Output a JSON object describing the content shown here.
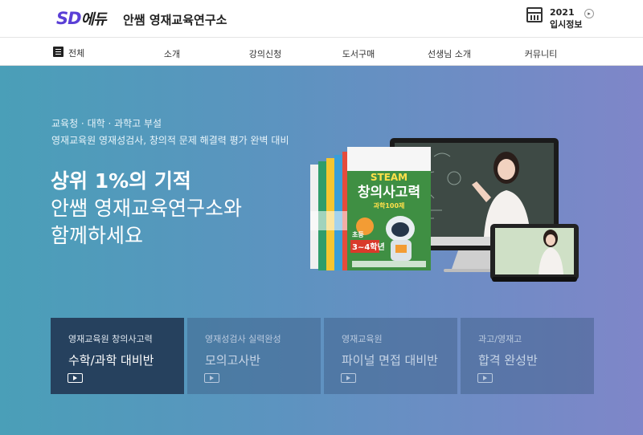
{
  "brand": {
    "logo_sd": "SD",
    "logo_edu": "에듀",
    "org_name": "안쌤 영재교육연구소"
  },
  "header_info": {
    "year": "2021",
    "label": "입시정보",
    "icon": "calendar-icon",
    "arrow_icon": "chevron-right-icon"
  },
  "nav": {
    "all_label": "전체",
    "items": [
      "소개",
      "강의신청",
      "도서구매",
      "선생님 소개",
      "커뮤니티"
    ]
  },
  "hero": {
    "sub1": "교육청 · 대학 · 과학고 부설",
    "sub2": "영재교육원 영재성검사, 창의적 문제 해결력 평가 완벽 대비",
    "title1": "상위 1%의 기적",
    "title2": "안쌤 영재교육연구소와",
    "title3": "함께하세요",
    "book": {
      "badge": "STEAM",
      "title": "창의사고력",
      "subtitle": "과학100제",
      "grade_prefix": "초등",
      "grade": "3~4학년"
    }
  },
  "courses": [
    {
      "category": "영재교육원 창의사고력",
      "name": "수학/과학 대비반",
      "active": true
    },
    {
      "category": "영재성검사 실력완성",
      "name": "모의고사반",
      "active": false
    },
    {
      "category": "영재교육원",
      "name": "파이널 면접 대비반",
      "active": false
    },
    {
      "category": "과고/영재고",
      "name": "합격 완성반",
      "active": false
    }
  ],
  "colors": {
    "brand_purple": "#5a3fd6",
    "hero_start": "#4a9fb8",
    "hero_end": "#7f86c9",
    "card_active": "#26415e"
  }
}
